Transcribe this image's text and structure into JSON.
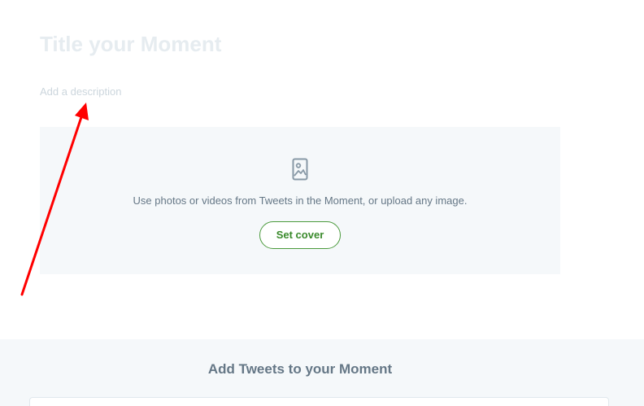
{
  "moment": {
    "title_placeholder": "Title your Moment",
    "description_placeholder": "Add a description"
  },
  "cover": {
    "icon": "image-placeholder-icon",
    "hint_text": "Use photos or videos from Tweets in the Moment, or upload any image.",
    "set_cover_label": "Set cover"
  },
  "add_tweets": {
    "heading": "Add Tweets to your Moment"
  },
  "colors": {
    "accent_green": "#3a8a2c",
    "panel_bg": "#f5f8fa",
    "annotation_red": "#ff0000"
  }
}
